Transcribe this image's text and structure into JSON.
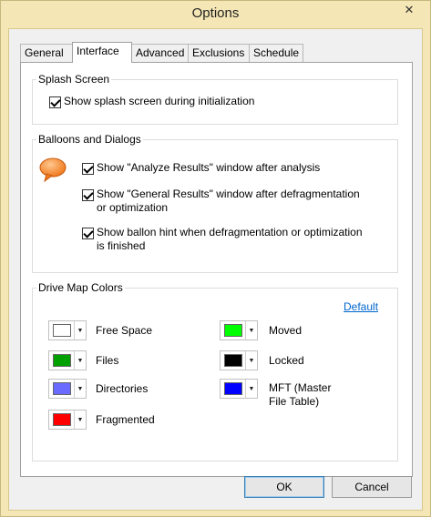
{
  "window": {
    "title": "Options",
    "close_symbol": "✕"
  },
  "tabs": [
    {
      "label": "General"
    },
    {
      "label": "Interface"
    },
    {
      "label": "Advanced"
    },
    {
      "label": "Exclusions"
    },
    {
      "label": "Schedule"
    }
  ],
  "active_tab": "Interface",
  "splash": {
    "title": "Splash Screen",
    "show_splash": {
      "label": "Show splash screen during initialization",
      "checked": true
    }
  },
  "balloons": {
    "title": "Balloons and Dialogs",
    "items": [
      {
        "label": "Show \"Analyze Results\" window after analysis",
        "checked": true
      },
      {
        "label_line1": "Show \"General Results\" window after defragmentation",
        "label_line2": "or optimization",
        "checked": true
      },
      {
        "label_line1": "Show ballon hint when defragmentation or optimization",
        "label_line2": "is finished",
        "checked": true
      }
    ]
  },
  "drive_map": {
    "title": "Drive Map Colors",
    "default_link": "Default",
    "colors": [
      {
        "label": "Free Space",
        "color": "#ffffff"
      },
      {
        "label": "Files",
        "color": "#00a000"
      },
      {
        "label": "Directories",
        "color": "#6a6aff"
      },
      {
        "label": "Fragmented",
        "color": "#ff0000"
      },
      {
        "label": "Moved",
        "color": "#00ff00"
      },
      {
        "label": "Locked",
        "color": "#000000"
      },
      {
        "label_line1": "MFT (Master",
        "label_line2": "File Table)",
        "color": "#0000ff"
      }
    ]
  },
  "buttons": {
    "ok": "OK",
    "cancel": "Cancel"
  }
}
